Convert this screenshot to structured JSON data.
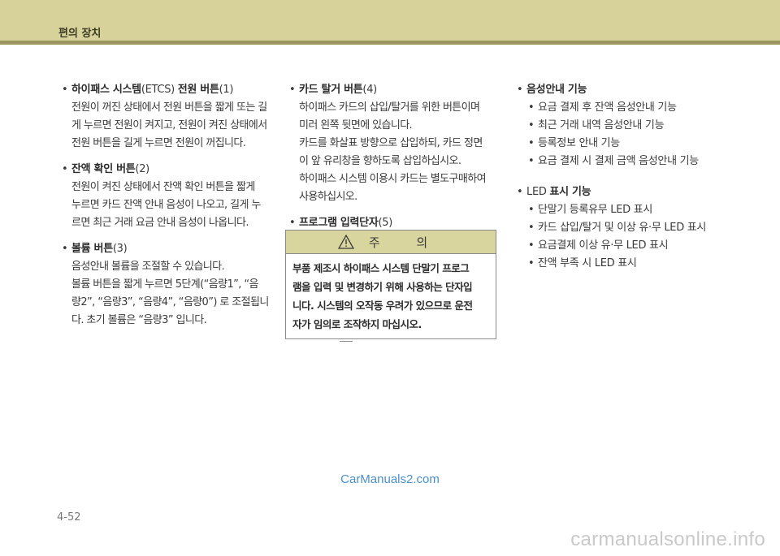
{
  "header": {
    "title": "편의 장치"
  },
  "col1": [
    {
      "bold": "하이패스 시스템",
      "normal": "(ETCS) ",
      "bold2": "전원 버튼",
      "normal2": "(1)",
      "lines": [
        "전원이 꺼진 상태에서 전원 버튼을 짧게 또는 길",
        "게 누르면 전원이 켜지고, 전원이 켜진 상태에서",
        "전원 버튼을 길게 누르면 전원이 꺼집니다."
      ]
    },
    {
      "bold": "잔액 확인 버튼",
      "normal": "(2)",
      "lines": [
        "전원이 켜진 상태에서 잔액 확인 버튼을 짧게",
        "누르면 카드 잔액 안내 음성이 나오고, 길게 누",
        "르면 최근 거래 요금 안내 음성이 나옵니다."
      ]
    },
    {
      "bold": "볼륨 버튼",
      "normal": "(3)",
      "lines": [
        "음성안내 볼륨을 조절할 수 있습니다.",
        "볼륨 버튼을 짧게 누르면 5단계(“음량1”, “음",
        "량2”, “음량3”, “음량4”, “음량0”) 로 조절됩니",
        "다. 초기 볼륨은 “음량3” 입니다."
      ]
    }
  ],
  "col2": [
    {
      "bold": "카드 탈거 버튼",
      "normal": "(4)",
      "lines": [
        "하이패스 카드의 삽입/탈거를 위한 버튼이며",
        "미러 왼쪽 뒷면에 있습니다.",
        "카드를 화살표 방향으로 삽입하되, 카드 정면",
        "이 앞 유리창을 향하도록 삽입하십시오.",
        "하이패스 시스템 이용시 카드는 별도구매하여",
        "사용하십시오."
      ]
    },
    {
      "bold": "프로그램 입력단자",
      "normal": "(5)",
      "lines": []
    }
  ],
  "caution": {
    "title": "주 의",
    "lines": [
      "부품 제조시 하이패스 시스템 단말기 프로그",
      "램을 입력 및 변경하기 위해 사용하는 단자입",
      "니다. 시스템의 오작동 우려가 있으므로 운전",
      "자가 임의로 조작하지 마십시오."
    ]
  },
  "col3": [
    {
      "bold": "음성안내 기능",
      "normal": "",
      "subs": [
        "요금 결제 후 잔액 음성안내 기능",
        "최근 거래 내역 음성안내 기능",
        "등록정보 안내 기능",
        "요금 결제 시 결제 금액 음성안내 기능"
      ]
    },
    {
      "prefix": "LED ",
      "bold": "표시 기능",
      "normal": "",
      "subs": [
        "단말기 등록유무 LED 표시",
        "카드 삽입/탈거 및 이상 유·무 LED 표시",
        "요금결제 이상 유·무 LED 표시",
        "잔액 부족 시 LED 표시"
      ]
    }
  ],
  "bullet": "•",
  "watermark": "CarManuals2.com",
  "page_number": "4-52",
  "site_watermark": "carmanualsonline.info",
  "colors": {
    "header": "#d6d29a",
    "stripe": "#9b9660",
    "caution_head": "#d9d59f",
    "watermark": "#4a90c8"
  }
}
